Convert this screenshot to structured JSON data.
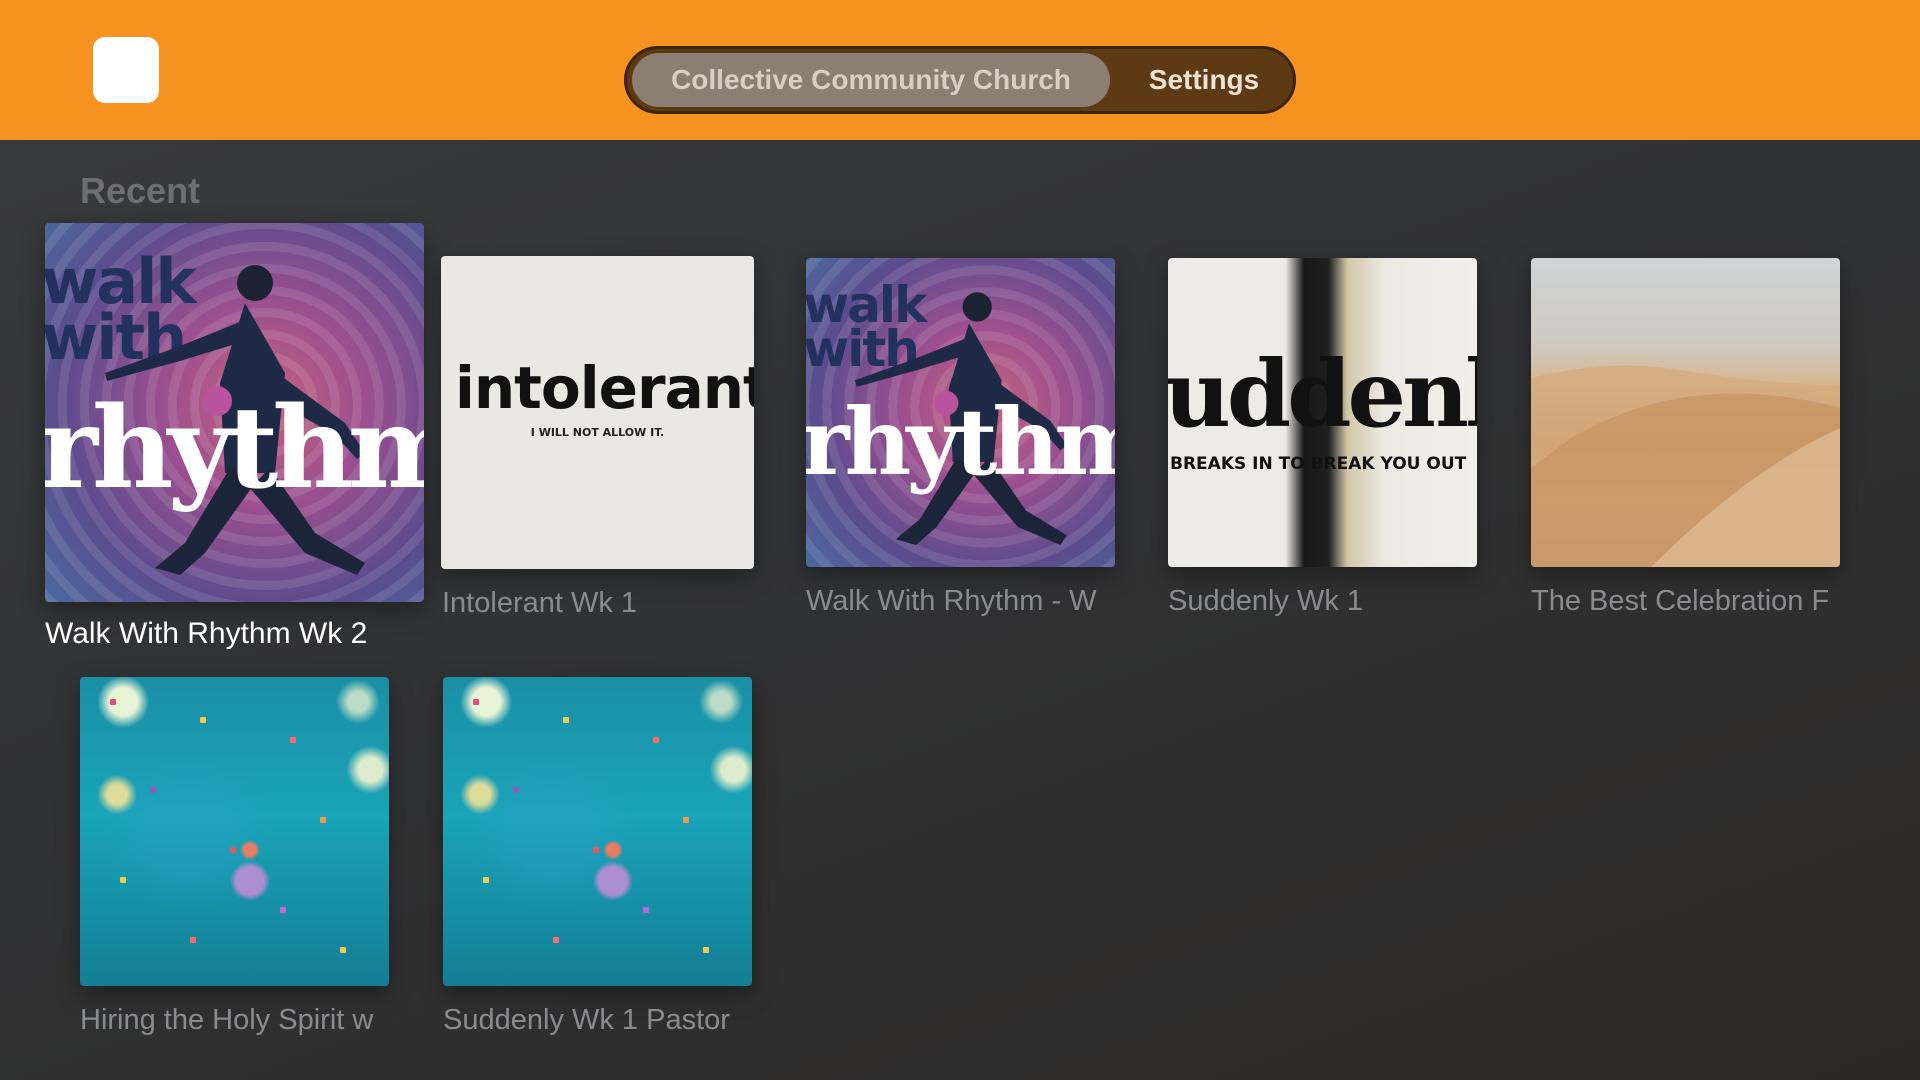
{
  "header": {
    "tabs": [
      {
        "label": "Collective Community Church",
        "active": true
      },
      {
        "label": "Settings",
        "active": false
      }
    ]
  },
  "section": {
    "title": "Recent"
  },
  "artwork_text": {
    "walk": "walk",
    "with": "with",
    "rhythm": "rhythm",
    "intolerant": "intolerant",
    "intolerant_sub": "I WILL NOT ALLOW IT.",
    "suddenly": "uddenl",
    "suddenly_sub": "BREAKS IN TO BREAK YOU OUT"
  },
  "items": [
    {
      "title": "Walk With Rhythm Wk 2",
      "focused": true
    },
    {
      "title": "Intolerant Wk 1",
      "focused": false
    },
    {
      "title": "Walk With Rhythm - W",
      "focused": false
    },
    {
      "title": "Suddenly Wk 1",
      "focused": false
    },
    {
      "title": "The Best Celebration F",
      "focused": false
    },
    {
      "title": "Hiring the Holy Spirit w",
      "focused": false
    },
    {
      "title": "Suddenly Wk 1 Pastor",
      "focused": false
    }
  ],
  "colors": {
    "header_bg": "#f6921f",
    "focused_caption": "#ffffff",
    "caption": "#8a8b8e"
  }
}
